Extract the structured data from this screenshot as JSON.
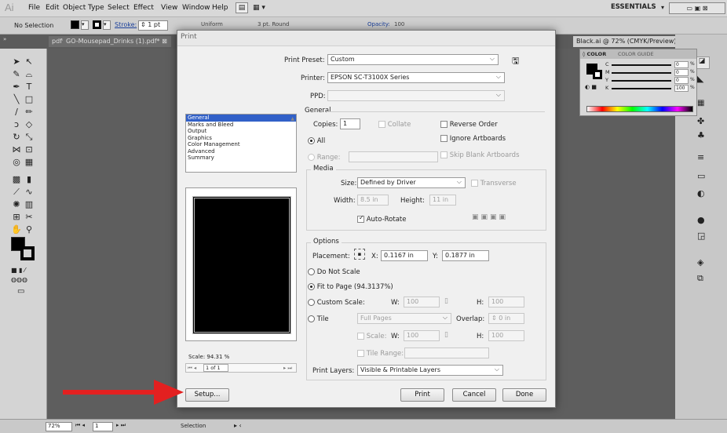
{
  "app": {
    "logo": "Ai",
    "menu": [
      "File",
      "Edit",
      "Object",
      "Type",
      "Select",
      "Effect",
      "View",
      "Window",
      "Help"
    ],
    "workspace_label": "ESSENTIALS"
  },
  "controlbar": {
    "selection": "No Selection",
    "stroke_label": "Stroke:",
    "stroke_value": "1 pt",
    "uniform": "Uniform",
    "brush": "3 pt. Round",
    "opacity_label": "Opacity:",
    "opacity_value": "100"
  },
  "tabs": [
    {
      "label": "pdf* ⊠"
    },
    {
      "label": "GO-Mousepad_Drinks (1).pdf* ⊠"
    },
    {
      "label": "Black.ai @ 72% (CMYK/Preview) ⊠"
    }
  ],
  "color_panel": {
    "tab1": "◊ COLOR",
    "tab2": "COLOR GUIDE",
    "rows": [
      {
        "label": "C",
        "value": "0",
        "unit": "%"
      },
      {
        "label": "M",
        "value": "0",
        "unit": "%"
      },
      {
        "label": "Y",
        "value": "0",
        "unit": "%"
      },
      {
        "label": "K",
        "value": "100",
        "unit": "%"
      }
    ]
  },
  "statusbar": {
    "zoom": "72%",
    "page": "1",
    "mode": "Selection"
  },
  "dialog": {
    "title": "Print",
    "print_preset_label": "Print Preset:",
    "print_preset_value": "Custom",
    "printer_label": "Printer:",
    "printer_value": "EPSON SC-T3100X Series",
    "ppd_label": "PPD:",
    "general_heading": "General",
    "categories": [
      "General",
      "Marks and Bleed",
      "Output",
      "Graphics",
      "Color Management",
      "Advanced",
      "Summary"
    ],
    "copies_label": "Copies:",
    "copies_value": "1",
    "collate_label": "Collate",
    "reverse_order_label": "Reverse Order",
    "all_label": "All",
    "ignore_artboards_label": "Ignore Artboards",
    "range_label": "Range:",
    "skip_blank_label": "Skip Blank Artboards",
    "media_heading": "Media",
    "size_label": "Size:",
    "size_value": "Defined by Driver",
    "transverse_label": "Transverse",
    "width_label": "Width:",
    "width_value": "8.5 in",
    "height_label": "Height:",
    "height_value": "11 in",
    "auto_rotate_label": "Auto-Rotate",
    "options_heading": "Options",
    "placement_label": "Placement:",
    "x_label": "X:",
    "x_value": "0.1167 in",
    "y_label": "Y:",
    "y_value": "0.1877 in",
    "do_not_scale_label": "Do Not Scale",
    "fit_to_page_label": "Fit to Page",
    "fit_to_page_pct": "(94.3137%)",
    "custom_scale_label": "Custom Scale:",
    "w_label": "W:",
    "w_value": "100",
    "h_label": "H:",
    "h_value": "100",
    "tile_label": "Tile",
    "tile_value": "Full Pages",
    "overlap_label": "Overlap:",
    "overlap_value": "0 in",
    "scale_label": "Scale:",
    "scale_w_label": "W:",
    "scale_w_value": "100",
    "scale_h_label": "H:",
    "scale_h_value": "100",
    "tile_range_label": "Tile Range:",
    "print_layers_label": "Print Layers:",
    "print_layers_value": "Visible & Printable Layers",
    "preview_scale": "Scale: 94.31 %",
    "page_nav": "1 of 1",
    "setup_label": "Setup...",
    "print_label": "Print",
    "cancel_label": "Cancel",
    "done_label": "Done"
  },
  "colors": {
    "arrow": "#e32020",
    "selection": "#3160c8"
  }
}
